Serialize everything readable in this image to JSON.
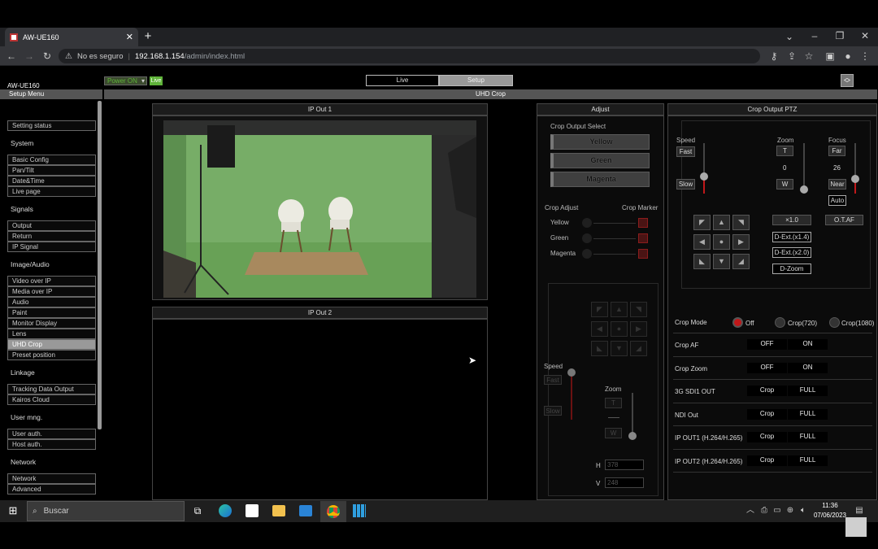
{
  "browser": {
    "tab_title": "AW-UE160",
    "not_secure": "No es seguro",
    "url_host": "192.168.1.154",
    "url_path": "/admin/index.html"
  },
  "header": {
    "device": "AW-UE160",
    "power": "Power ON",
    "live_badge": "Live",
    "mode_tabs": [
      "Live",
      "Setup"
    ],
    "setup_menu": "Setup Menu",
    "page_title": "UHD Crop"
  },
  "sidebar": {
    "items": [
      {
        "type": "btn",
        "label": "Setting status"
      },
      {
        "type": "sec",
        "label": "System"
      },
      {
        "type": "btn",
        "label": "Basic Config"
      },
      {
        "type": "btn",
        "label": "Pan/Tilt"
      },
      {
        "type": "btn",
        "label": "Date&Time"
      },
      {
        "type": "btn",
        "label": "Live page"
      },
      {
        "type": "sec",
        "label": "Signals"
      },
      {
        "type": "btn",
        "label": "Output"
      },
      {
        "type": "btn",
        "label": "Return"
      },
      {
        "type": "btn",
        "label": "IP Signal"
      },
      {
        "type": "sec",
        "label": "Image/Audio"
      },
      {
        "type": "btn",
        "label": "Video over IP"
      },
      {
        "type": "btn",
        "label": "Media over IP"
      },
      {
        "type": "btn",
        "label": "Audio"
      },
      {
        "type": "btn",
        "label": "Paint"
      },
      {
        "type": "btn",
        "label": "Monitor Display"
      },
      {
        "type": "btn",
        "label": "Lens"
      },
      {
        "type": "btn",
        "label": "UHD Crop",
        "selected": true
      },
      {
        "type": "btn",
        "label": "Preset position"
      },
      {
        "type": "sec",
        "label": "Linkage"
      },
      {
        "type": "btn",
        "label": "Tracking Data Output"
      },
      {
        "type": "btn",
        "label": "Kairos Cloud"
      },
      {
        "type": "sec",
        "label": "User mng."
      },
      {
        "type": "btn",
        "label": "User auth."
      },
      {
        "type": "btn",
        "label": "Host auth."
      },
      {
        "type": "sec",
        "label": "Network"
      },
      {
        "type": "btn",
        "label": "Network"
      },
      {
        "type": "btn",
        "label": "Advanced"
      }
    ]
  },
  "ip_out1": "IP Out 1",
  "ip_out2": "IP Out 2",
  "adjust": {
    "title": "Adjust",
    "crop_output_select": "Crop Output Select",
    "outputs": [
      "Yellow",
      "Green",
      "Magenta"
    ],
    "crop_adjust": "Crop Adjust",
    "crop_marker": "Crop Marker",
    "markers": [
      "Yellow",
      "Green",
      "Magenta"
    ],
    "speed": "Speed",
    "fast": "Fast",
    "slow": "Slow",
    "zoom": "Zoom",
    "t": "T",
    "w": "W",
    "h_label": "H",
    "h_value": "378",
    "v_label": "V",
    "v_value": "248"
  },
  "ptz": {
    "title": "Crop Output PTZ",
    "speed": "Speed",
    "fast": "Fast",
    "slow": "Slow",
    "zoom": "Zoom",
    "t": "T",
    "zoom_value": "0",
    "w": "W",
    "focus": "Focus",
    "far": "Far",
    "focus_value": "26",
    "near": "Near",
    "auto": "Auto",
    "x10": "×1.0",
    "dext14": "D-Ext.(x1.4)",
    "dext20": "D-Ext.(x2.0)",
    "dzoom": "D-Zoom",
    "otaf": "O.T.AF"
  },
  "settings": {
    "crop_mode": "Crop Mode",
    "mode_opts": [
      "Off",
      "Crop(720)",
      "Crop(1080)"
    ],
    "rows": [
      {
        "label": "Crop AF",
        "a": "OFF",
        "b": "ON"
      },
      {
        "label": "Crop Zoom",
        "a": "OFF",
        "b": "ON"
      },
      {
        "label": "3G SDI1 OUT",
        "a": "Crop",
        "b": "FULL"
      },
      {
        "label": "NDI Out",
        "a": "Crop",
        "b": "FULL"
      },
      {
        "label": "IP OUT1 (H.264/H.265)",
        "a": "Crop",
        "b": "FULL"
      },
      {
        "label": "IP OUT2 (H.264/H.265)",
        "a": "Crop",
        "b": "FULL"
      }
    ]
  },
  "taskbar": {
    "search": "Buscar",
    "time": "11:36",
    "date": "07/06/2023"
  },
  "colors": {
    "marker_red": "#8a1c1c",
    "radio_on": "#c0181a",
    "power_green": "#5fb33a",
    "greenscreen": "#6fa65e"
  }
}
